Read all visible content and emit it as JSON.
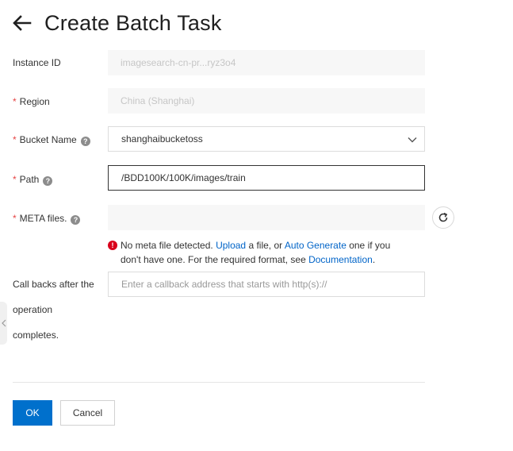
{
  "header": {
    "title": "Create Batch Task",
    "back_icon": "arrow-left-icon"
  },
  "form": {
    "instance_id": {
      "label": "Instance ID",
      "value": "imagesearch-cn-pr...ryz3o4"
    },
    "region": {
      "label": "Region",
      "required": "*",
      "value": "China (Shanghai)"
    },
    "bucket_name": {
      "label": "Bucket Name",
      "required": "*",
      "help": "?",
      "value": "shanghaibucketoss"
    },
    "path": {
      "label": "Path",
      "required": "*",
      "help": "?",
      "value": "/BDD100K/100K/images/train"
    },
    "meta_files": {
      "label": "META files.",
      "required": "*",
      "help": "?",
      "value": "",
      "error": {
        "icon": "!",
        "text_1": "No meta file detected. ",
        "link_upload": "Upload",
        "text_2": " a file, or ",
        "link_auto": "Auto Generate",
        "text_3": " one if you don't have one. For the required format, see ",
        "link_docs": "Documentation",
        "text_4": "."
      }
    },
    "callback": {
      "label_line1": "Call backs after the",
      "label_line2": "operation",
      "label_line3": "completes.",
      "placeholder": "Enter a callback address that starts with http(s)://"
    }
  },
  "buttons": {
    "ok": "OK",
    "cancel": "Cancel"
  },
  "colors": {
    "primary": "#0070cc",
    "link": "#0064c8",
    "required": "#e64545",
    "error": "#d9001b"
  }
}
